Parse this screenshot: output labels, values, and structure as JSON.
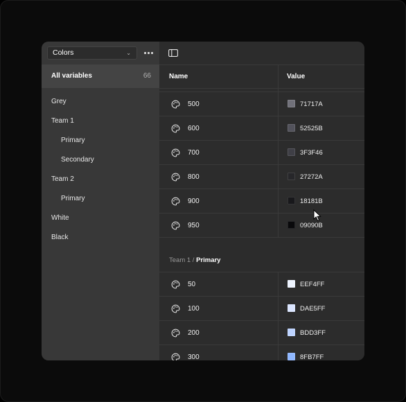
{
  "sidebar": {
    "collection_select": "Colors",
    "all_variables": {
      "label": "All variables",
      "count": "66"
    },
    "groups": [
      {
        "label": "Grey"
      },
      {
        "label": "Team 1"
      },
      {
        "label": "Primary"
      },
      {
        "label": "Secondary"
      },
      {
        "label": "Team 2"
      },
      {
        "label": "Primary"
      },
      {
        "label": "White"
      },
      {
        "label": "Black"
      }
    ]
  },
  "table": {
    "headers": {
      "name": "Name",
      "value": "Value"
    },
    "grey_rows": [
      {
        "name": "500",
        "value": "71717A",
        "color": "#71717A"
      },
      {
        "name": "600",
        "value": "52525B",
        "color": "#52525B"
      },
      {
        "name": "700",
        "value": "3F3F46",
        "color": "#3F3F46"
      },
      {
        "name": "800",
        "value": "27272A",
        "color": "#27272A"
      },
      {
        "name": "900",
        "value": "18181B",
        "color": "#18181B"
      },
      {
        "name": "950",
        "value": "09090B",
        "color": "#09090B"
      }
    ],
    "section": {
      "prefix": "Team 1 / ",
      "name": "Primary"
    },
    "team1_rows": [
      {
        "name": "50",
        "value": "EEF4FF",
        "color": "#EEF4FF"
      },
      {
        "name": "100",
        "value": "DAE5FF",
        "color": "#DAE5FF"
      },
      {
        "name": "200",
        "value": "BDD3FF",
        "color": "#BDD3FF"
      },
      {
        "name": "300",
        "value": "8FB7FF",
        "color": "#8FB7FF"
      }
    ]
  },
  "icons": {
    "more": "more-horizontal-icon",
    "sidebar_toggle": "sidebar-toggle-icon",
    "palette": "palette-icon",
    "cursor": "mouse-pointer-icon"
  }
}
